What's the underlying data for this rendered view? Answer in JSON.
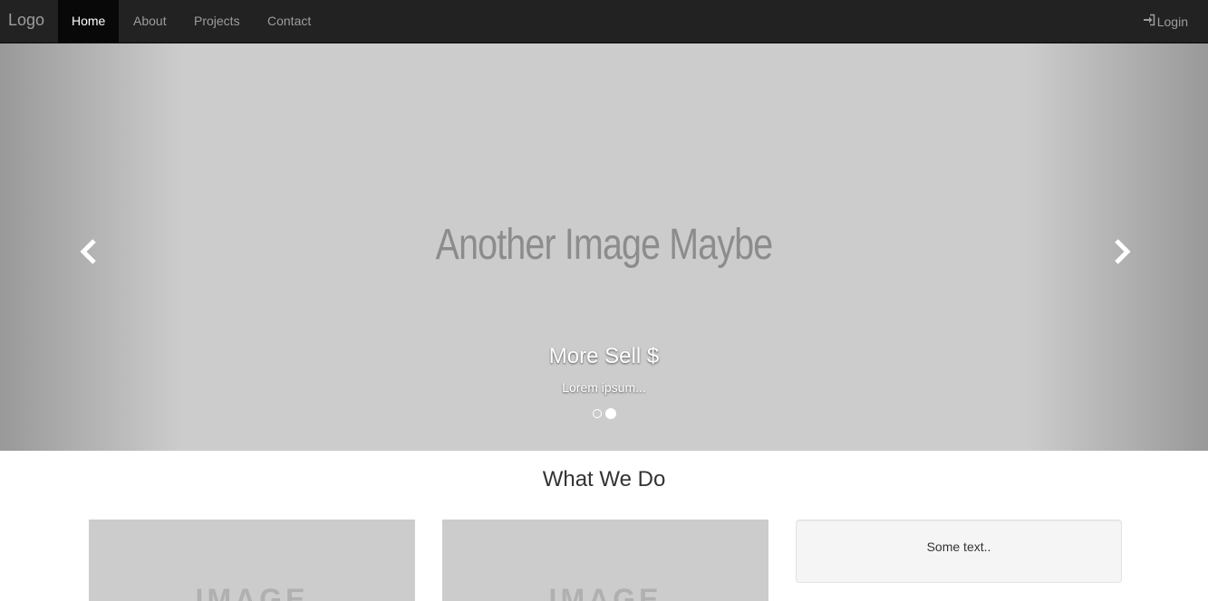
{
  "navbar": {
    "brand": "Logo",
    "items": [
      {
        "label": "Home",
        "active": true
      },
      {
        "label": "About",
        "active": false
      },
      {
        "label": "Projects",
        "active": false
      },
      {
        "label": "Contact",
        "active": false
      }
    ],
    "login_label": "Login",
    "login_icon": "login-icon"
  },
  "carousel": {
    "image_text": "Another Image Maybe",
    "caption_title": "More Sell $",
    "caption_body": "Lorem ipsum...",
    "indicator_count": 2,
    "active_indicator": 2,
    "prev_icon": "chevron-left-icon",
    "next_icon": "chevron-right-icon"
  },
  "section": {
    "title": "What We Do"
  },
  "cards": {
    "image_labels": [
      "IMAGE",
      "IMAGE"
    ],
    "well_text": "Some text.."
  },
  "colors": {
    "navbar_bg": "#222222",
    "active_nav_bg": "#080808",
    "carousel_bg": "#cccccc",
    "well_bg": "#f5f5f5"
  }
}
